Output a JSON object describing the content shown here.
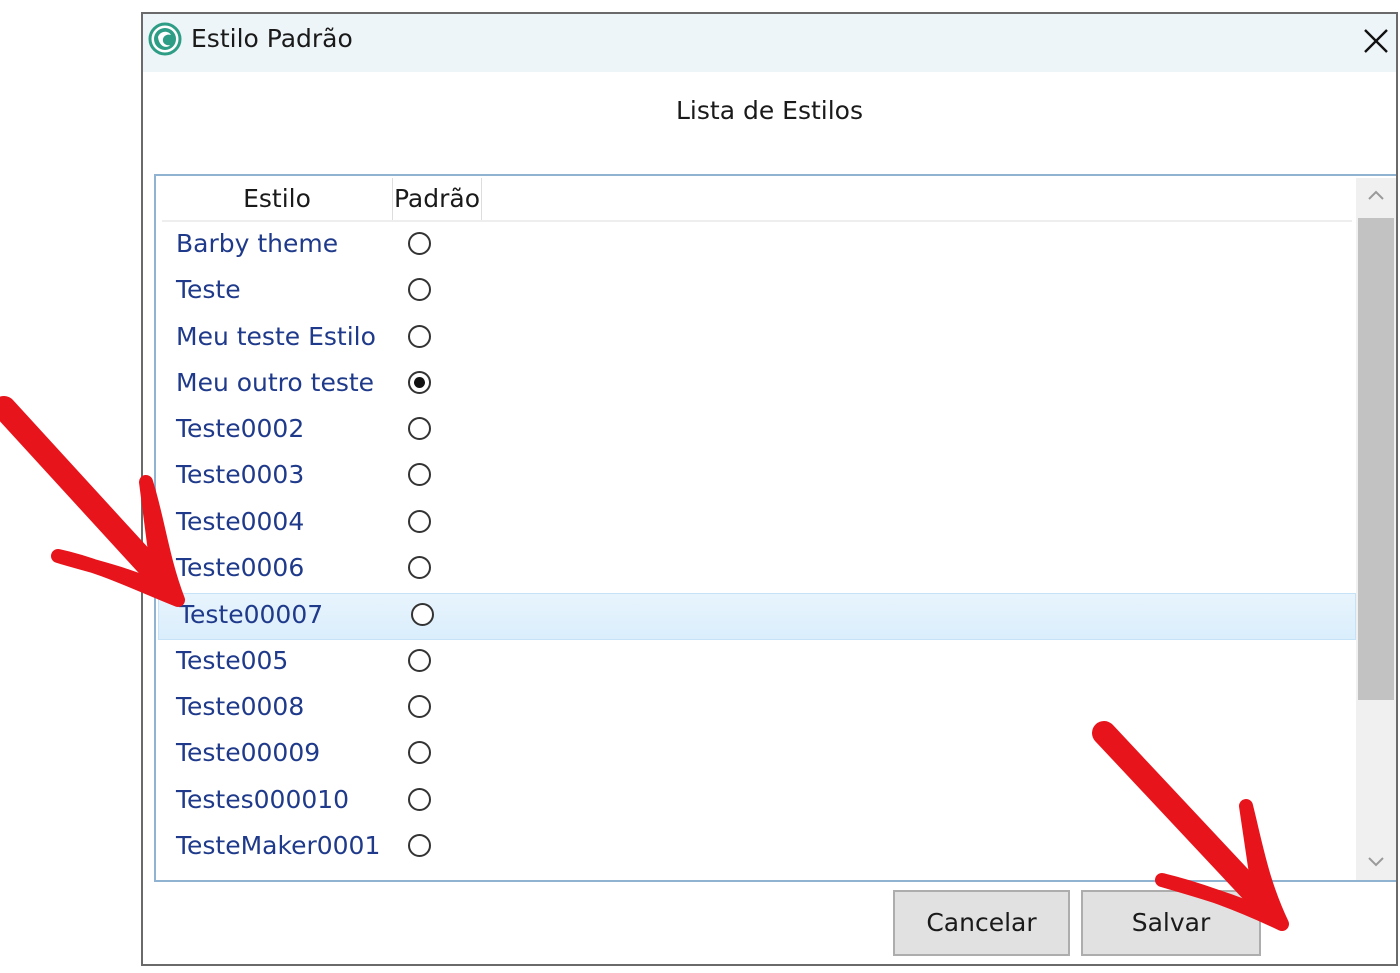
{
  "window": {
    "title": "Estilo Padrão"
  },
  "dialog": {
    "heading": "Lista de Estilos"
  },
  "list": {
    "columns": {
      "estilo": "Estilo",
      "padrao": "Padrão"
    },
    "rows": [
      {
        "name": "Barby theme",
        "checked": false,
        "color": "#1f3a8a"
      },
      {
        "name": "Teste",
        "checked": false,
        "color": "#1f3a8a"
      },
      {
        "name": "Meu teste Estilo",
        "checked": false,
        "color": "#1f3a8a"
      },
      {
        "name": "Meu outro teste",
        "checked": true,
        "color": "#1f3a8a"
      },
      {
        "name": "Teste0002",
        "checked": false,
        "color": "#1f3a8a"
      },
      {
        "name": "Teste0003",
        "checked": false,
        "color": "#1f3a8a"
      },
      {
        "name": "Teste0004",
        "checked": false,
        "color": "#1f3a8a"
      },
      {
        "name": "Teste0006",
        "checked": false,
        "color": "#1f3a8a"
      },
      {
        "name": "Teste00007",
        "checked": false,
        "color": "#1f3a8a",
        "hover": true
      },
      {
        "name": "Teste005",
        "checked": false,
        "color": "#1f3a8a"
      },
      {
        "name": "Teste0008",
        "checked": false,
        "color": "#1f3a8a"
      },
      {
        "name": "Teste00009",
        "checked": false,
        "color": "#1f3a8a"
      },
      {
        "name": "Testes000010",
        "checked": false,
        "color": "#1f3a8a"
      },
      {
        "name": "TesteMaker0001",
        "checked": false,
        "color": "#1f3a8a"
      }
    ]
  },
  "buttons": {
    "cancel": "Cancelar",
    "save": "Salvar"
  },
  "colors": {
    "accent": "#1f3a8a",
    "annotation_arrow": "#e8141b",
    "app_icon": "#2e9d86"
  },
  "icons": {
    "app": "app-logo-icon",
    "close": "close-icon",
    "scroll_up": "chevron-up-icon",
    "scroll_down": "chevron-down-icon"
  }
}
